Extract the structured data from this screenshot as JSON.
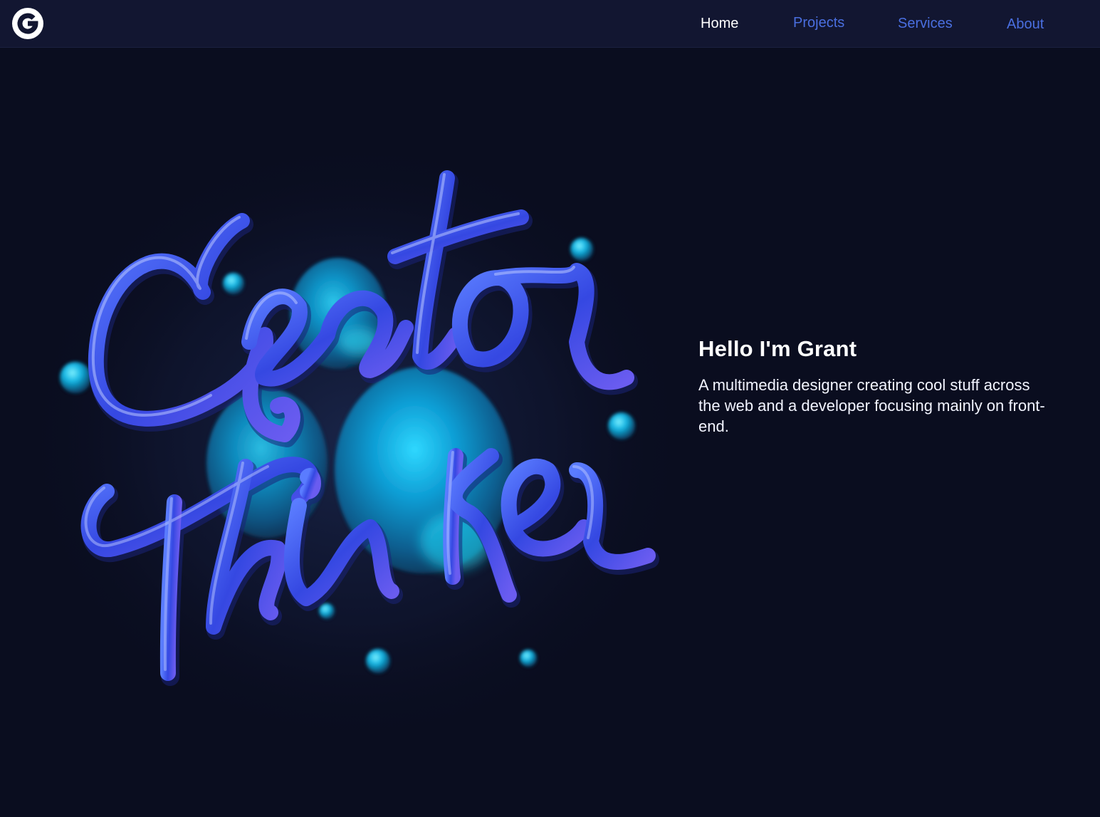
{
  "header": {
    "logo_icon": "g-logo-icon",
    "nav": {
      "home": "Home",
      "projects": "Projects",
      "services": "Services",
      "about": "About"
    }
  },
  "hero": {
    "artwork_lettering": [
      "Creator",
      "Thinker"
    ],
    "intro_title": "Hello I'm Grant",
    "intro_body": "A multimedia designer creating cool stuff across the web and a developer focusing mainly on front-end."
  },
  "colors": {
    "background": "#0a0d1f",
    "header_bg": "#121631",
    "nav_active": "#ffffff",
    "nav_link": "#4a6fe0",
    "tube_blue": "#3f59e8",
    "blob_cyan": "#12b8e6"
  }
}
